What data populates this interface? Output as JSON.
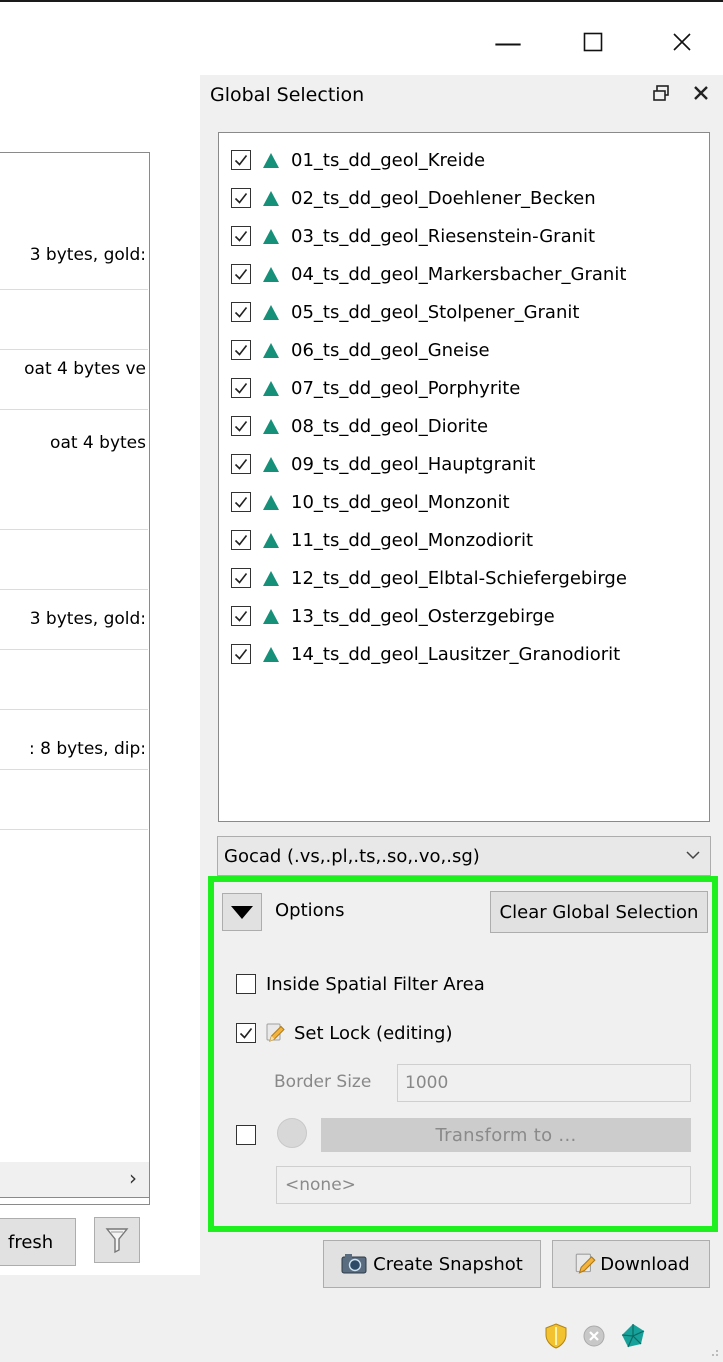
{
  "window": {
    "minimize_glyph": "—",
    "maximize_glyph": "☐",
    "close_glyph": "✕"
  },
  "left_pane": {
    "rows": [
      "3 bytes, gold:",
      "oat 4 bytes ve",
      "oat 4 bytes",
      "3 bytes, gold:",
      ": 8 bytes, dip:"
    ],
    "refresh_label": "fresh",
    "scroll_right_glyph": "›"
  },
  "dock": {
    "title": "Global Selection",
    "float_glyph": "🗗",
    "close_glyph": "✕"
  },
  "selection": {
    "accent_color": "#17907a",
    "items": [
      {
        "label": "01_ts_dd_geol_Kreide",
        "checked": true
      },
      {
        "label": "02_ts_dd_geol_Doehlener_Becken",
        "checked": true
      },
      {
        "label": "03_ts_dd_geol_Riesenstein-Granit",
        "checked": true
      },
      {
        "label": "04_ts_dd_geol_Markersbacher_Granit",
        "checked": true
      },
      {
        "label": "05_ts_dd_geol_Stolpener_Granit",
        "checked": true
      },
      {
        "label": "06_ts_dd_geol_Gneise",
        "checked": true
      },
      {
        "label": "07_ts_dd_geol_Porphyrite",
        "checked": true
      },
      {
        "label": "08_ts_dd_geol_Diorite",
        "checked": true
      },
      {
        "label": "09_ts_dd_geol_Hauptgranit",
        "checked": true
      },
      {
        "label": "10_ts_dd_geol_Monzonit",
        "checked": true
      },
      {
        "label": "11_ts_dd_geol_Monzodiorit",
        "checked": true
      },
      {
        "label": "12_ts_dd_geol_Elbtal-Schiefergebirge",
        "checked": true
      },
      {
        "label": "13_ts_dd_geol_Osterzgebirge",
        "checked": true
      },
      {
        "label": "14_ts_dd_geol_Lausitzer_Granodiorit",
        "checked": true
      }
    ]
  },
  "format": {
    "selected": "Gocad (.vs,.pl,.ts,.so,.vo,.sg)"
  },
  "options": {
    "label": "Options",
    "clear_label": "Clear Global Selection",
    "inside_spatial_filter": {
      "label": "Inside Spatial Filter Area",
      "checked": false
    },
    "set_lock": {
      "label": "Set Lock (editing)",
      "checked": true
    },
    "border_size": {
      "label": "Border Size",
      "value": "1000"
    },
    "transform": {
      "label": "Transform to ...",
      "checked": false
    },
    "crs": "<none>",
    "highlight_color": "#1ef01e"
  },
  "actions": {
    "snapshot_label": "Create Snapshot",
    "download_label": "Download"
  }
}
